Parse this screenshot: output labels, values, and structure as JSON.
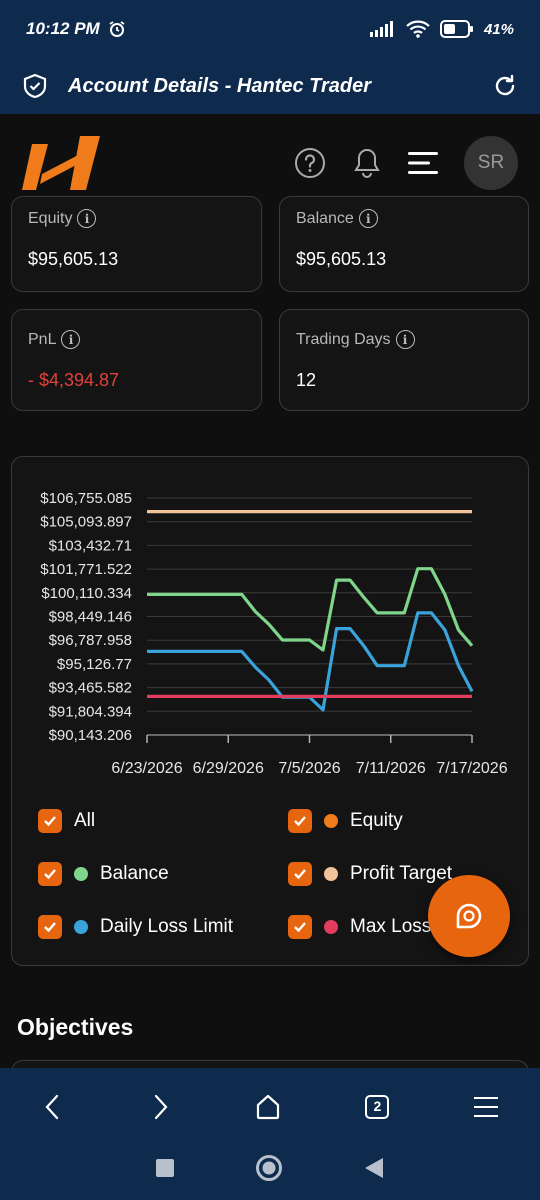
{
  "status": {
    "time": "10:12 PM",
    "battery": "41%"
  },
  "browser": {
    "title": "Account Details - Hantec Trader"
  },
  "header": {
    "avatar_initials": "SR"
  },
  "stats": {
    "equity": {
      "label": "Equity",
      "value": "$95,605.13"
    },
    "balance": {
      "label": "Balance",
      "value": "$95,605.13"
    },
    "pnl": {
      "label": "PnL",
      "value": "- $4,394.87"
    },
    "trading_days": {
      "label": "Trading Days",
      "value": "12"
    }
  },
  "chart_data": {
    "type": "line",
    "y_ticks": [
      "$106,755.085",
      "$105,093.897",
      "$103,432.71",
      "$101,771.522",
      "$100,110.334",
      "$98,449.146",
      "$96,787.958",
      "$95,126.77",
      "$93,465.582",
      "$91,804.394",
      "$90,143.206"
    ],
    "x_ticks": [
      "6/23/2026",
      "6/29/2026",
      "7/5/2026",
      "7/11/2026",
      "7/17/2026"
    ],
    "ylim": [
      90143.206,
      106755.085
    ],
    "x_range": [
      0,
      24
    ],
    "grid": true,
    "series": [
      {
        "name": "Profit Target",
        "color": "#f2c29b",
        "points": [
          [
            0,
            105800
          ],
          [
            24,
            105800
          ]
        ]
      },
      {
        "name": "Balance",
        "color": "#7fd68a",
        "points": [
          [
            0,
            100000
          ],
          [
            7,
            100000
          ],
          [
            8,
            98800
          ],
          [
            9,
            97900
          ],
          [
            10,
            96800
          ],
          [
            12,
            96800
          ],
          [
            13,
            96100
          ],
          [
            14,
            101000
          ],
          [
            15,
            101000
          ],
          [
            16,
            99800
          ],
          [
            17,
            98700
          ],
          [
            19,
            98700
          ],
          [
            20,
            101800
          ],
          [
            21,
            101800
          ],
          [
            22,
            100000
          ],
          [
            23,
            97500
          ],
          [
            24,
            96400
          ]
        ]
      },
      {
        "name": "Daily Loss Limit",
        "color": "#3aa3dc",
        "points": [
          [
            0,
            96000
          ],
          [
            7,
            96000
          ],
          [
            8,
            94900
          ],
          [
            9,
            94000
          ],
          [
            10,
            92800
          ],
          [
            12,
            92800
          ],
          [
            13,
            91900
          ],
          [
            14,
            97600
          ],
          [
            15,
            97600
          ],
          [
            16,
            96400
          ],
          [
            17,
            95000
          ],
          [
            19,
            95000
          ],
          [
            20,
            98700
          ],
          [
            21,
            98700
          ],
          [
            22,
            97500
          ],
          [
            23,
            95000
          ],
          [
            24,
            93200
          ]
        ]
      },
      {
        "name": "Max Loss",
        "color": "#e23d5e",
        "points": [
          [
            0,
            92850
          ],
          [
            24,
            92850
          ]
        ]
      }
    ]
  },
  "legend": {
    "all": "All",
    "equity": {
      "label": "Equity",
      "color": "#f07b1a"
    },
    "balance": {
      "label": "Balance",
      "color": "#7fd68a"
    },
    "profit_target": {
      "label": "Profit Target",
      "color": "#f2c29b"
    },
    "daily_loss": {
      "label": "Daily Loss Limit",
      "color": "#3aa3dc"
    },
    "max_loss": {
      "label": "Max Loss",
      "color": "#e23d5e"
    }
  },
  "sections": {
    "objectives": "Objectives"
  },
  "nav": {
    "tab_count": "2"
  },
  "colors": {
    "accent": "#e8650f",
    "bar": "#0e2a4d",
    "loss": "#e0413a"
  }
}
